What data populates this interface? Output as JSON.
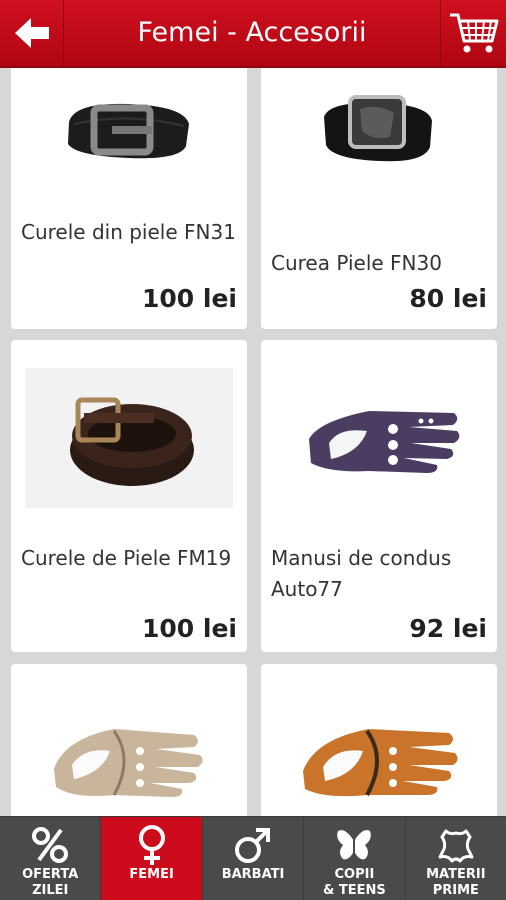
{
  "header": {
    "title": "Femei - Accesorii",
    "back_icon": "arrow-left-icon",
    "cart_icon": "shopping-cart-icon",
    "accent": "#c90a1a"
  },
  "products": [
    {
      "name": "Curele din piele FN31",
      "price": "100 lei",
      "image": "black-belt-silver-buckle"
    },
    {
      "name": "Curea Piele FN30",
      "price": "80 lei",
      "image": "black-belt-glossy-buckle"
    },
    {
      "name": "Curele de Piele FM19",
      "price": "100 lei",
      "image": "brown-croc-belt"
    },
    {
      "name": "Manusi de condus Auto77",
      "price": "92 lei",
      "image": "purple-driving-glove"
    },
    {
      "name": "",
      "price": "",
      "image": "beige-driving-glove"
    },
    {
      "name": "",
      "price": "",
      "image": "orange-driving-glove"
    }
  ],
  "nav": {
    "items": [
      {
        "label": "OFERTA\nZILEI",
        "icon": "percent-icon"
      },
      {
        "label": "FEMEI",
        "icon": "female-icon"
      },
      {
        "label": "BARBATI",
        "icon": "male-icon"
      },
      {
        "label": "COPII\n& TEENS",
        "icon": "butterfly-icon"
      },
      {
        "label": "MATERII\nPRIME",
        "icon": "leather-hide-icon"
      }
    ],
    "active_index": 1,
    "active_color": "#cc0c1c",
    "bg_color": "#4a4a4a"
  }
}
